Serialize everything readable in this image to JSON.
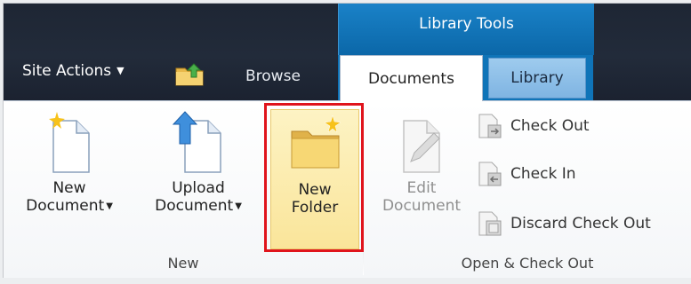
{
  "context_group": {
    "title": "Library Tools"
  },
  "nav": {
    "site_actions": "Site Actions",
    "browse": "Browse"
  },
  "tabs": [
    {
      "label": "Documents",
      "selected": true
    },
    {
      "label": "Library",
      "selected": false
    }
  ],
  "groups": [
    {
      "label": "New",
      "buttons": [
        {
          "line1": "New",
          "line2": "Document",
          "has_dropdown": true,
          "icon": "new-document-icon"
        },
        {
          "line1": "Upload",
          "line2": "Document",
          "has_dropdown": true,
          "icon": "upload-document-icon"
        },
        {
          "line1": "New",
          "line2": "Folder",
          "has_dropdown": false,
          "icon": "new-folder-icon",
          "highlighted": true
        }
      ]
    },
    {
      "label": "Open & Check Out",
      "buttons": [
        {
          "line1": "Edit",
          "line2": "Document",
          "enabled": false,
          "icon": "edit-document-icon"
        }
      ],
      "small_buttons": [
        {
          "label": "Check Out",
          "icon": "check-out-icon"
        },
        {
          "label": "Check In",
          "icon": "check-in-icon"
        },
        {
          "label": "Discard Check Out",
          "icon": "discard-check-out-icon"
        }
      ]
    }
  ],
  "colors": {
    "topbar": "#222b3a",
    "context_group": "#0f74b8",
    "highlight": "#e0141c",
    "folder_button_bg": "#fae59a"
  }
}
